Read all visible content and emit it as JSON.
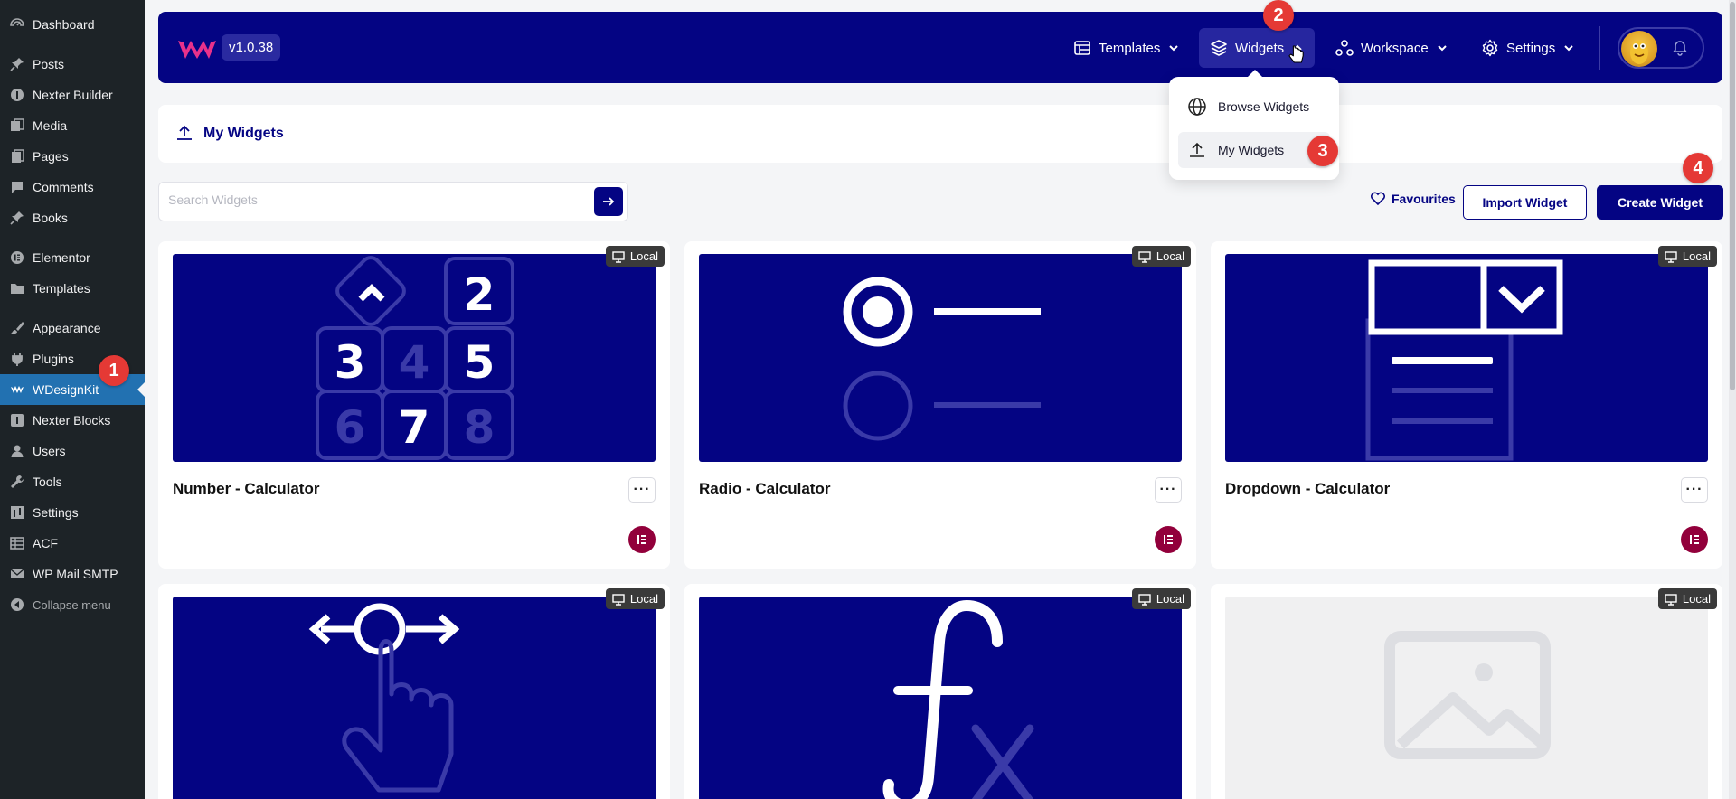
{
  "sidebar": {
    "items": [
      {
        "label": "Dashboard",
        "icon": "dashboard-icon"
      },
      {
        "label": "Posts",
        "icon": "pin-icon"
      },
      {
        "label": "Nexter Builder",
        "icon": "info-icon"
      },
      {
        "label": "Media",
        "icon": "media-icon"
      },
      {
        "label": "Pages",
        "icon": "pages-icon"
      },
      {
        "label": "Comments",
        "icon": "comment-icon"
      },
      {
        "label": "Books",
        "icon": "pin-icon"
      },
      {
        "label": "Elementor",
        "icon": "elementor-icon"
      },
      {
        "label": "Templates",
        "icon": "folder-icon"
      },
      {
        "label": "Appearance",
        "icon": "brush-icon"
      },
      {
        "label": "Plugins",
        "icon": "plugin-icon"
      },
      {
        "label": "WDesignKit",
        "icon": "wdesignkit-icon"
      },
      {
        "label": "Nexter Blocks",
        "icon": "blocks-icon"
      },
      {
        "label": "Users",
        "icon": "user-icon"
      },
      {
        "label": "Tools",
        "icon": "wrench-icon"
      },
      {
        "label": "Settings",
        "icon": "settings-icon"
      },
      {
        "label": "ACF",
        "icon": "table-icon"
      },
      {
        "label": "WP Mail SMTP",
        "icon": "mail-icon"
      },
      {
        "label": "Collapse menu",
        "icon": "collapse-icon"
      }
    ]
  },
  "steps": [
    "1",
    "2",
    "3",
    "4"
  ],
  "header": {
    "version": "v1.0.38",
    "nav": {
      "templates": "Templates",
      "widgets": "Widgets",
      "workspace": "Workspace",
      "settings": "Settings"
    }
  },
  "dropdown": {
    "browse": "Browse Widgets",
    "my": "My Widgets"
  },
  "subheader": {
    "title": "My Widgets"
  },
  "toolbar": {
    "search_placeholder": "Search Widgets",
    "favourites": "Favourites",
    "import": "Import Widget",
    "create": "Create Widget"
  },
  "cards": [
    {
      "name": "Number - Calculator",
      "badge": "Local"
    },
    {
      "name": "Radio - Calculator",
      "badge": "Local"
    },
    {
      "name": "Dropdown - Calculator",
      "badge": "Local"
    },
    {
      "name": "",
      "badge": "Local"
    },
    {
      "name": "",
      "badge": "Local"
    },
    {
      "name": "",
      "badge": "Local"
    }
  ],
  "colors": {
    "brand": "#040483",
    "step": "#e53935",
    "wp_active": "#2271b1",
    "elementor": "#92003b"
  }
}
